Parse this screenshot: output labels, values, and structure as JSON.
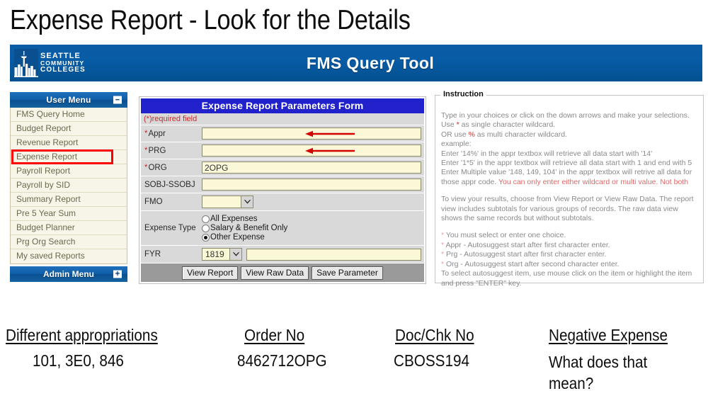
{
  "slide": {
    "title": "Expense Report - Look for the Details"
  },
  "banner": {
    "app_title": "FMS Query Tool",
    "logo": {
      "line1": "SEATTLE",
      "line2": "COMMUNITY",
      "line3": "COLLEGES",
      "icon": "space-needle-skyline-icon"
    },
    "background_color": "#075ba5"
  },
  "sidebar": {
    "user_menu": {
      "label": "User Menu",
      "toggle_glyph": "–",
      "toggle_state": "collapse"
    },
    "items": [
      {
        "label": "FMS Query Home",
        "highlighted": false
      },
      {
        "label": "Budget Report",
        "highlighted": false
      },
      {
        "label": "Revenue Report",
        "highlighted": false
      },
      {
        "label": "Expense Report",
        "highlighted": true
      },
      {
        "label": "Payroll Report",
        "highlighted": false
      },
      {
        "label": "Payroll by SID",
        "highlighted": false
      },
      {
        "label": "Summary Report",
        "highlighted": false
      },
      {
        "label": "Pre 5 Year Sum",
        "highlighted": false
      },
      {
        "label": "Budget Planner",
        "highlighted": false
      },
      {
        "label": "Prg Org Search",
        "highlighted": false
      },
      {
        "label": "My saved Reports",
        "highlighted": false
      }
    ],
    "admin_menu": {
      "label": "Admin Menu",
      "toggle_glyph": "+",
      "toggle_state": "expand"
    },
    "highlight_color": "#ff0000"
  },
  "form": {
    "title": "Expense Report Parameters Form",
    "required_note": "(*)required field",
    "title_bg": "#2222cc",
    "fields": {
      "appr": {
        "label": "Appr",
        "required": true,
        "value": "",
        "annotated": true
      },
      "prg": {
        "label": "PRG",
        "required": true,
        "value": "",
        "annotated": true
      },
      "org": {
        "label": "ORG",
        "required": true,
        "value": "2OPG",
        "annotated": false
      },
      "sobj": {
        "label": "SOBJ-SSOBJ",
        "required": false,
        "value": "",
        "annotated": false
      },
      "fmo": {
        "label": "FMO",
        "required": false,
        "value": "",
        "type": "select"
      },
      "fyr": {
        "label": "FYR",
        "required": false,
        "value": "1819",
        "type": "select",
        "extra_value": ""
      }
    },
    "expense_type": {
      "label": "Expense Type",
      "options": [
        {
          "label": "All Expenses",
          "selected": false
        },
        {
          "label": "Salary & Benefit Only",
          "selected": false
        },
        {
          "label": "Other Expense",
          "selected": true
        }
      ]
    },
    "buttons": [
      {
        "label": "View Report"
      },
      {
        "label": "View Raw Data"
      },
      {
        "label": "Save Parameter"
      }
    ],
    "annotation_arrow_color": "#d40000"
  },
  "instruction": {
    "legend": "Instruction",
    "line1": "Type in your choices or click on the down arrows and make your selections.",
    "line2_pre": "Use ",
    "line2_wc": "*",
    "line2_post": " as single character wildcard.",
    "line3_pre": "OR use ",
    "line3_wc": "%",
    "line3_post": " as multi character wildcard.",
    "line4": "example:",
    "line5": "Enter '14%' in the appr textbox will retrieve all data start with '14'",
    "line6": "Enter '1*5' in the appr textbox will retrieve all data start with 1 and end with 5",
    "line7": "Enter Multiple value '148, 149, 104' in the appr textbox will retrive all data for",
    "line8_pre": "those appr code. ",
    "line8_warn": "You can only enter either wildcard or multi value. Not both",
    "para2_line1": "To view your results, choose from View Report or View Raw Data. The report",
    "para2_line2": "view includes subtotals for various groups of records. The raw data view",
    "para2_line3": "shows the same records but without subtotals.",
    "bullet1": "You must select or enter one choice.",
    "bullet2": "Appr - Autosuggest start after first character enter.",
    "bullet3": "Prg - Autosuggest start after first character enter.",
    "bullet4": "Org - Autosuggest start after second character enter.",
    "footer_line1": "To select autosuggest item, use mouse click on the item or highlight the item",
    "footer_line2": "and press \"ENTER\" key."
  },
  "notes": [
    {
      "heading": "Different appropriations",
      "value": "101, 3E0, 846"
    },
    {
      "heading": "Order No",
      "value": "8462712OPG"
    },
    {
      "heading": "Doc/Chk No",
      "value": "CBOSS194"
    },
    {
      "heading": "Negative Expense",
      "value": "What does that mean?"
    }
  ]
}
